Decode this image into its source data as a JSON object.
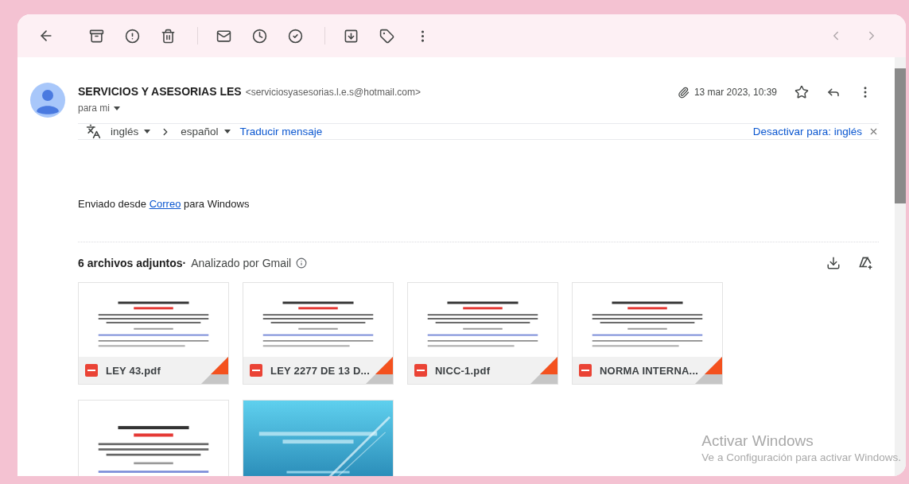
{
  "message": {
    "sender_name": "SERVICIOS Y ASESORIAS LES",
    "sender_email": "<serviciosyasesorias.l.e.s@hotmail.com>",
    "recipient": "para mi",
    "date": "13 mar 2023, 10:39"
  },
  "translation": {
    "from": "inglés",
    "to": "español",
    "action": "Traducir mensaje",
    "disable": "Desactivar para: inglés"
  },
  "body": {
    "before": "Enviado desde",
    "link": "Correo",
    "after": "para Windows"
  },
  "attachments": {
    "title": "6 archivos adjuntos·",
    "scan_note": "Analizado por Gmail",
    "items": [
      {
        "name": "LEY 43.pdf",
        "kind": "document"
      },
      {
        "name": "LEY 2277 DE 13 D...",
        "kind": "document"
      },
      {
        "name": "NICC-1.pdf",
        "kind": "document"
      },
      {
        "name": "NORMA INTERNA...",
        "kind": "document"
      },
      {
        "kind": "document"
      },
      {
        "kind": "slides"
      }
    ]
  },
  "activation": {
    "title": "Activar Windows",
    "text": "Ve a Configuración para activar Windows."
  }
}
